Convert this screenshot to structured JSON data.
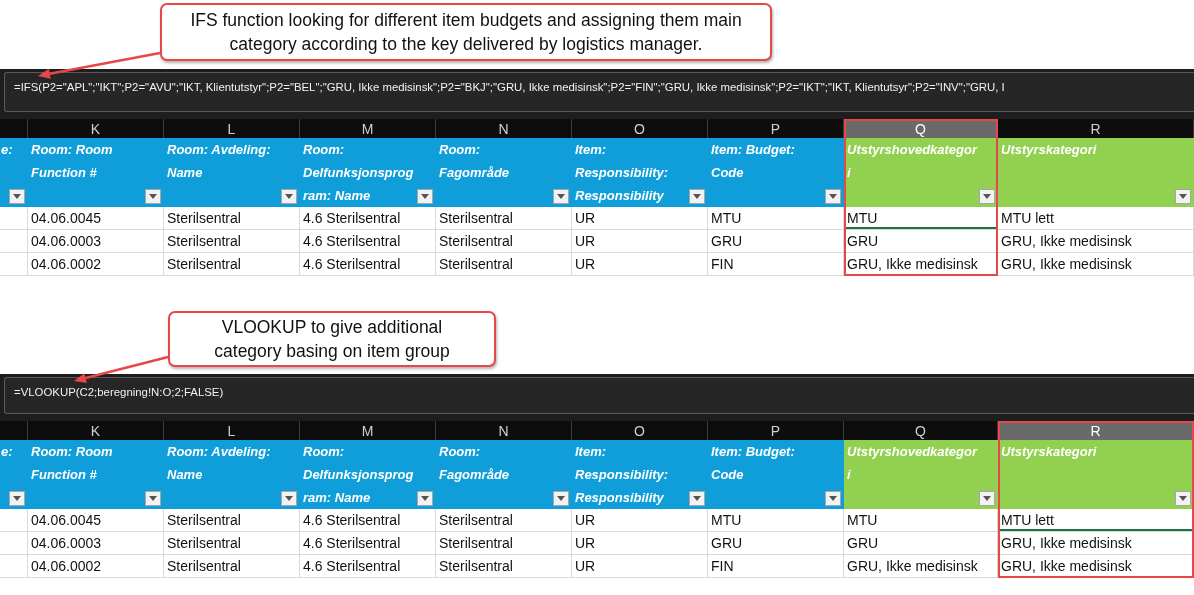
{
  "panels": [
    {
      "callout": "IFS function looking for different item budgets and assigning them main category according to the key delivered by logistics manager.",
      "formula": "=IFS(P2=\"APL\";\"IKT\";P2=\"AVU\";\"IKT, Klientutstyr\";P2=\"BEL\";\"GRU, Ikke medisinsk\";P2=\"BKJ\";\"GRU, Ikke medisinsk\";P2=\"FIN\";\"GRU, Ikke medisinsk\";P2=\"IKT\";\"IKT, Klientutsyr\";P2=\"INV\";\"GRU, I",
      "columns": [
        {
          "header": "e:",
          "selected": false,
          "color": "#0f9ed9"
        },
        {
          "letter": "K",
          "header": "Room: Room Function #",
          "selected": false,
          "color": "#0f9ed9"
        },
        {
          "letter": "L",
          "header": "Room: Avdeling: Name",
          "selected": false,
          "color": "#0f9ed9"
        },
        {
          "letter": "M",
          "header": "Room: Delfunksjonsprogram: Name",
          "selected": false,
          "color": "#0f9ed9"
        },
        {
          "letter": "N",
          "header": "Room: Fagområde",
          "selected": false,
          "color": "#0f9ed9"
        },
        {
          "letter": "O",
          "header": "Item: Responsibility: Responsibility",
          "selected": false,
          "color": "#0f9ed9"
        },
        {
          "letter": "P",
          "header": "Item: Budget: Code",
          "selected": false,
          "color": "#0f9ed9"
        },
        {
          "letter": "Q",
          "header": "Utstyrshovedkategori",
          "selected": true,
          "color": "#92d050"
        },
        {
          "letter": "R",
          "header": "Utstyrskategori",
          "selected": false,
          "color": "#92d050"
        }
      ],
      "rows": [
        [
          {
            "active": false
          },
          {
            "text": "04.06.0045",
            "active": false
          },
          {
            "text": "Sterilsentral",
            "active": false
          },
          {
            "text": "4.6 Sterilsentral",
            "active": false
          },
          {
            "text": "Sterilsentral",
            "active": false
          },
          {
            "text": "UR",
            "active": false
          },
          {
            "text": "MTU",
            "active": false
          },
          {
            "text": "MTU",
            "active": true
          },
          {
            "text": "MTU lett",
            "active": false
          }
        ],
        [
          {
            "active": false
          },
          {
            "text": "04.06.0003",
            "active": false
          },
          {
            "text": "Sterilsentral",
            "active": false
          },
          {
            "text": "4.6 Sterilsentral",
            "active": false
          },
          {
            "text": "Sterilsentral",
            "active": false
          },
          {
            "text": "UR",
            "active": false
          },
          {
            "text": "GRU",
            "active": false
          },
          {
            "text": "GRU",
            "active": false
          },
          {
            "text": "GRU, Ikke medisinsk",
            "active": false
          }
        ],
        [
          {
            "active": false
          },
          {
            "text": "04.06.0002",
            "active": false
          },
          {
            "text": "Sterilsentral",
            "active": false
          },
          {
            "text": "4.6 Sterilsentral",
            "active": false
          },
          {
            "text": "Sterilsentral",
            "active": false
          },
          {
            "text": "UR",
            "active": false
          },
          {
            "text": "FIN",
            "active": false
          },
          {
            "text": "GRU, Ikke medisinsk",
            "active": false
          },
          {
            "text": "GRU, Ikke medisinsk",
            "active": false
          }
        ]
      ]
    },
    {
      "callout": "VLOOKUP to give additional category basing on item group",
      "formula": "=VLOOKUP(C2;beregning!N:O;2;FALSE)",
      "columns": [
        {
          "header": "e:",
          "selected": false,
          "color": "#0f9ed9"
        },
        {
          "letter": "K",
          "header": "Room: Room Function #",
          "selected": false,
          "color": "#0f9ed9"
        },
        {
          "letter": "L",
          "header": "Room: Avdeling: Name",
          "selected": false,
          "color": "#0f9ed9"
        },
        {
          "letter": "M",
          "header": "Room: Delfunksjonsprogram: Name",
          "selected": false,
          "color": "#0f9ed9"
        },
        {
          "letter": "N",
          "header": "Room: Fagområde",
          "selected": false,
          "color": "#0f9ed9"
        },
        {
          "letter": "O",
          "header": "Item: Responsibility: Responsibility",
          "selected": false,
          "color": "#0f9ed9"
        },
        {
          "letter": "P",
          "header": "Item: Budget: Code",
          "selected": false,
          "color": "#0f9ed9"
        },
        {
          "letter": "Q",
          "header": "Utstyrshovedkategori",
          "selected": false,
          "color": "#92d050"
        },
        {
          "letter": "R",
          "header": "Utstyrskategori",
          "selected": true,
          "color": "#92d050"
        }
      ],
      "rows": [
        [
          {
            "active": false
          },
          {
            "text": "04.06.0045",
            "active": false
          },
          {
            "text": "Sterilsentral",
            "active": false
          },
          {
            "text": "4.6 Sterilsentral",
            "active": false
          },
          {
            "text": "Sterilsentral",
            "active": false
          },
          {
            "text": "UR",
            "active": false
          },
          {
            "text": "MTU",
            "active": false
          },
          {
            "text": "MTU",
            "active": false
          },
          {
            "text": "MTU lett",
            "active": true
          }
        ],
        [
          {
            "active": false
          },
          {
            "text": "04.06.0003",
            "active": false
          },
          {
            "text": "Sterilsentral",
            "active": false
          },
          {
            "text": "4.6 Sterilsentral",
            "active": false
          },
          {
            "text": "Sterilsentral",
            "active": false
          },
          {
            "text": "UR",
            "active": false
          },
          {
            "text": "GRU",
            "active": false
          },
          {
            "text": "GRU",
            "active": false
          },
          {
            "text": "GRU, Ikke medisinsk",
            "active": false
          }
        ],
        [
          {
            "active": false
          },
          {
            "text": "04.06.0002",
            "active": false
          },
          {
            "text": "Sterilsentral",
            "active": false
          },
          {
            "text": "4.6 Sterilsentral",
            "active": false
          },
          {
            "text": "Sterilsentral",
            "active": false
          },
          {
            "text": "UR",
            "active": false
          },
          {
            "text": "FIN",
            "active": false
          },
          {
            "text": "GRU, Ikke medisinsk",
            "active": false
          },
          {
            "text": "GRU, Ikke medisinsk",
            "active": false
          }
        ]
      ]
    }
  ]
}
